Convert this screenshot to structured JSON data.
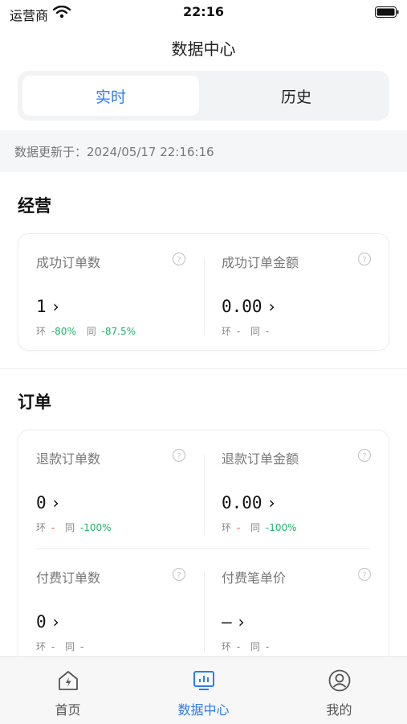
{
  "status_bar": {
    "carrier": "运营商",
    "time": "22:16"
  },
  "nav": {
    "title": "数据中心"
  },
  "segment": {
    "active": "实时",
    "inactive": "历史"
  },
  "update": {
    "text": "数据更新于：2024/05/17 22:16:16"
  },
  "sections": {
    "operation": {
      "title": "经营",
      "metrics": [
        {
          "label": "成功订单数",
          "value": "1",
          "ring_label": "环",
          "ring_value": "-80%",
          "yoy_label": "同",
          "yoy_value": "-87.5%"
        },
        {
          "label": "成功订单金额",
          "value": "0.00",
          "ring_label": "环",
          "ring_value": "-",
          "yoy_label": "同",
          "yoy_value": "-"
        }
      ]
    },
    "orders": {
      "title": "订单",
      "metrics": [
        {
          "label": "退款订单数",
          "value": "0",
          "ring_label": "环",
          "ring_value": "-",
          "yoy_label": "同",
          "yoy_value": "-100%"
        },
        {
          "label": "退款订单金额",
          "value": "0.00",
          "ring_label": "环",
          "ring_value": "-",
          "yoy_label": "同",
          "yoy_value": "-100%"
        },
        {
          "label": "付费订单数",
          "value": "0",
          "ring_label": "环",
          "ring_value": "-",
          "yoy_label": "同",
          "yoy_value": "-"
        },
        {
          "label": "付费笔单价",
          "value": "–",
          "ring_label": "环",
          "ring_value": "-",
          "yoy_label": "同",
          "yoy_value": "-"
        }
      ]
    }
  },
  "tabbar": {
    "items": [
      {
        "label": "首页",
        "icon": "home-icon"
      },
      {
        "label": "数据中心",
        "icon": "chart-icon"
      },
      {
        "label": "我的",
        "icon": "profile-icon"
      }
    ],
    "active_color": "#2d7bf5"
  },
  "colors": {
    "accent": "#2d7bf5",
    "positive": "#1fb36b",
    "negative": "#f04a3e"
  }
}
